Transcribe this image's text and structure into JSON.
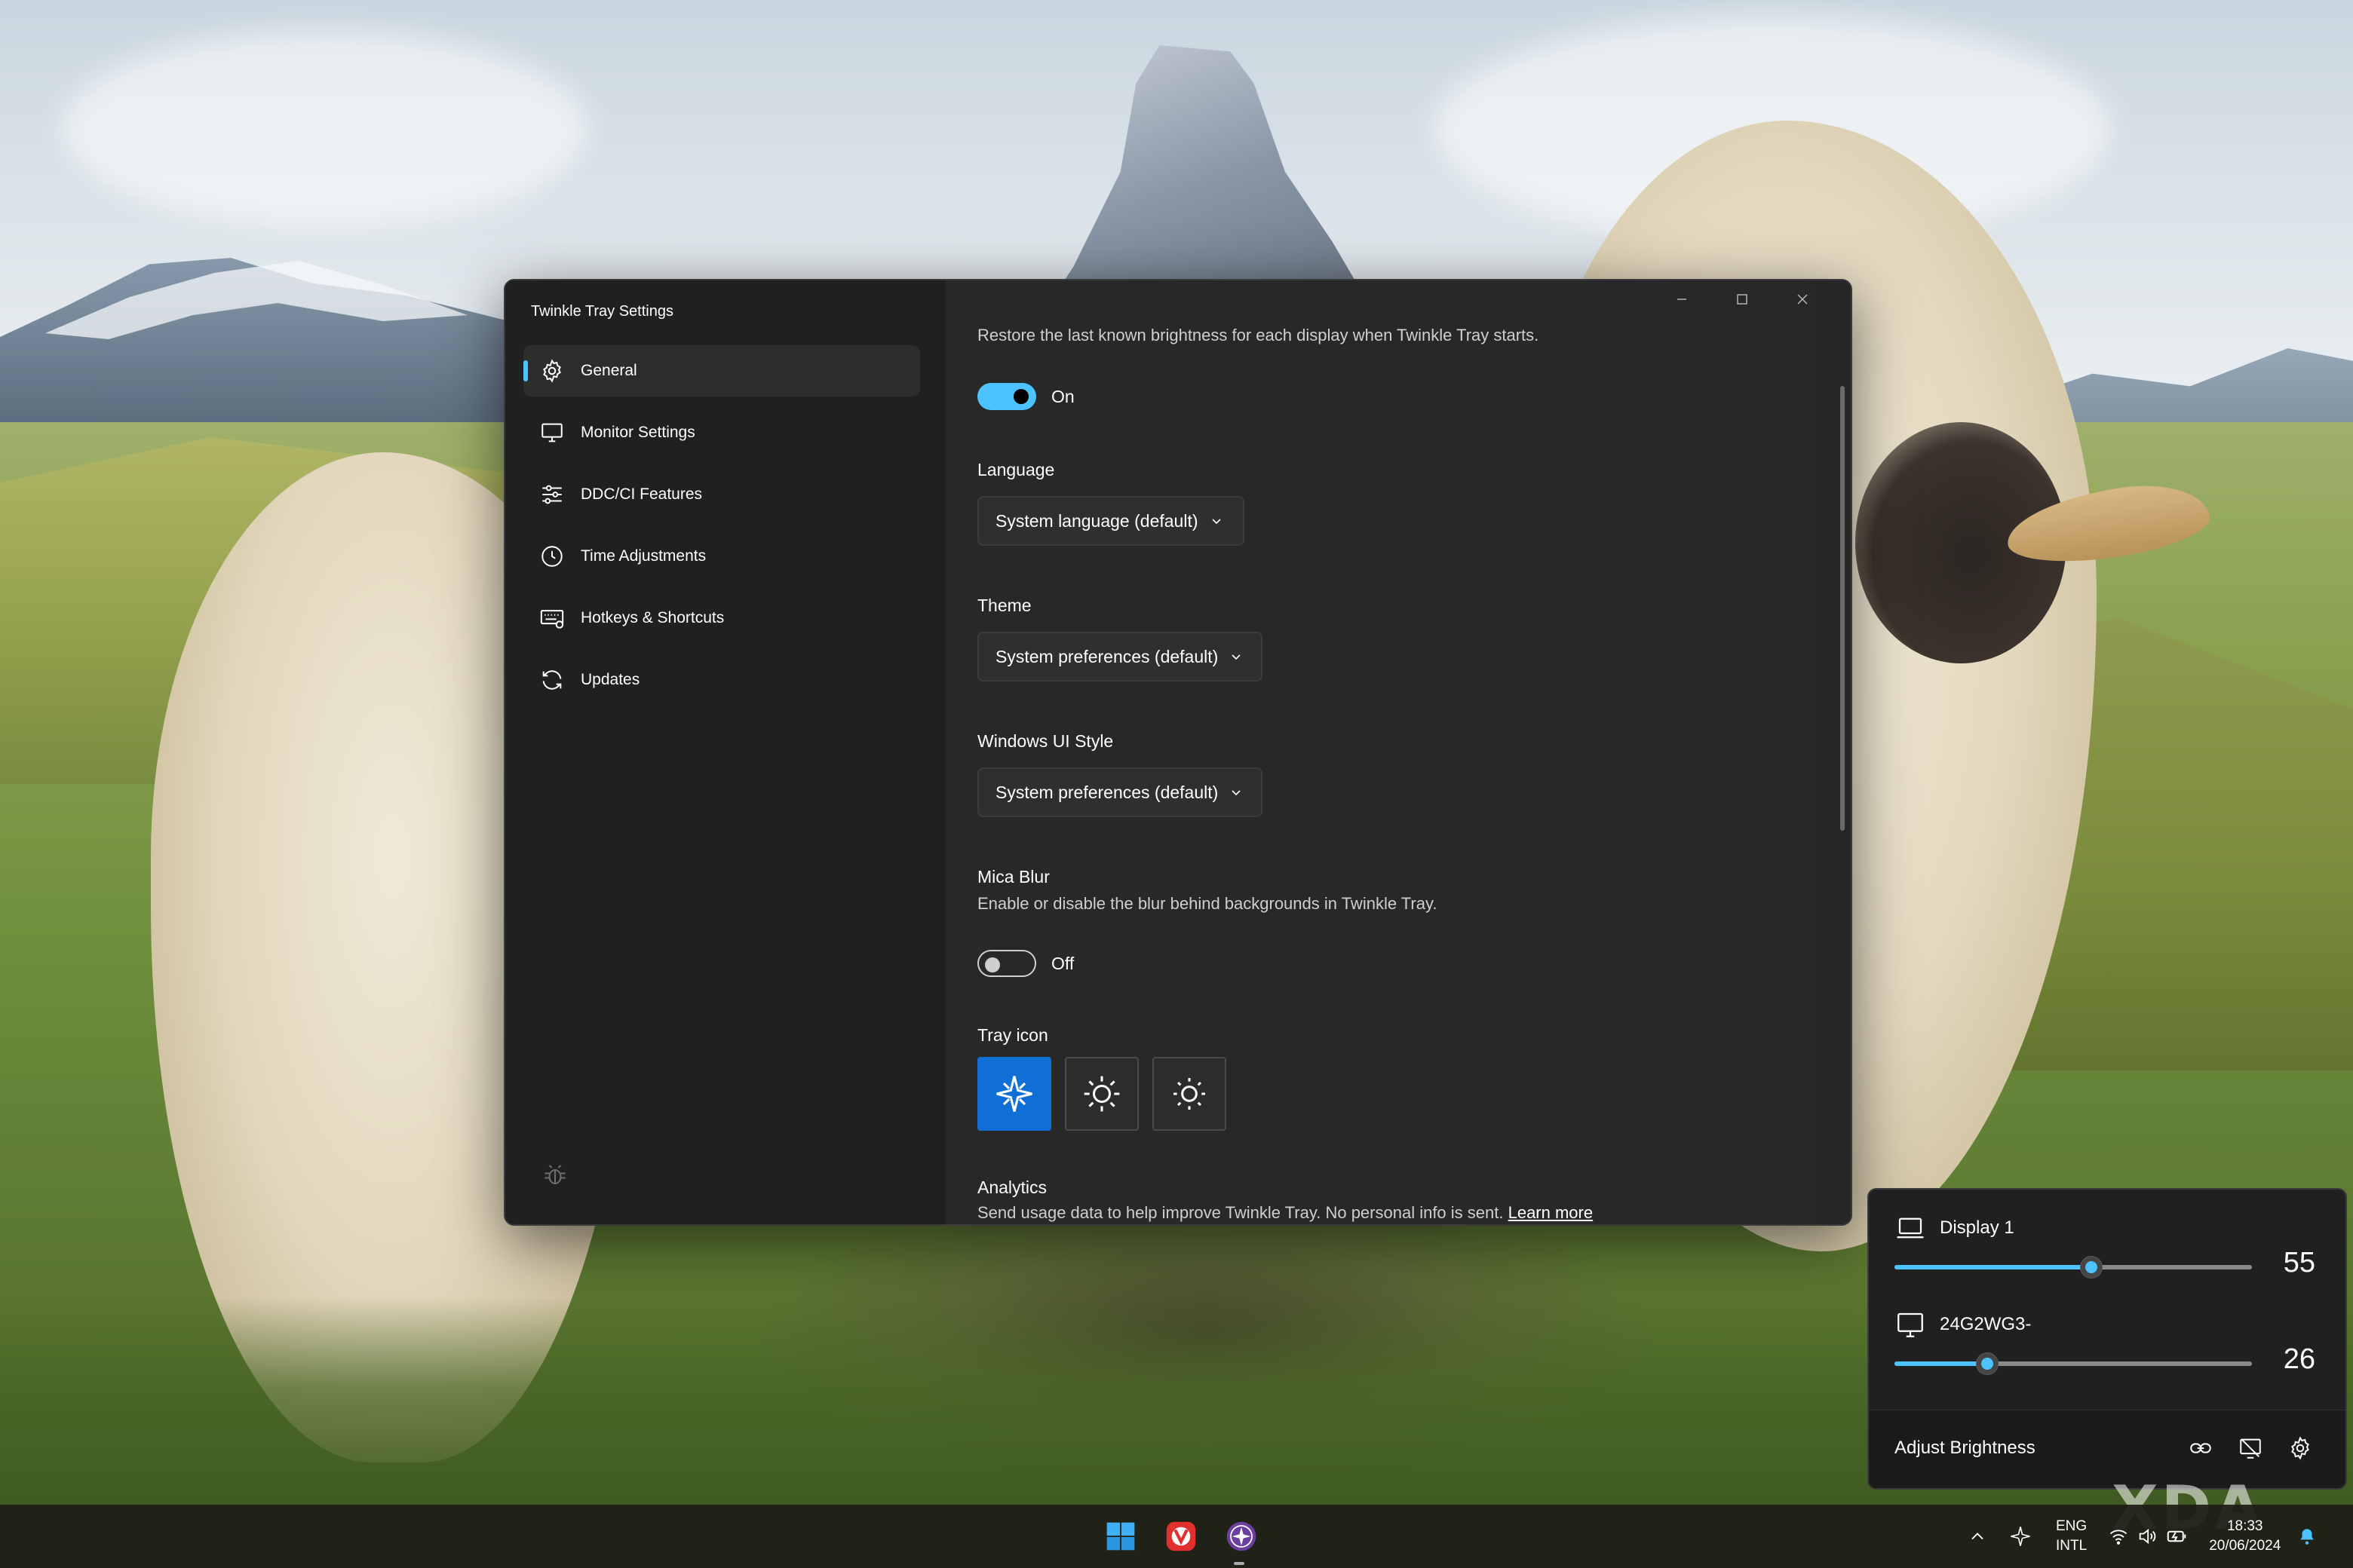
{
  "window": {
    "title": "Twinkle Tray Settings",
    "controls": [
      "minimize-icon",
      "maximize-icon",
      "close-icon"
    ]
  },
  "sidebar": {
    "items": [
      {
        "label": "General",
        "icon": "gear-icon",
        "active": true
      },
      {
        "label": "Monitor Settings",
        "icon": "monitor-icon",
        "active": false
      },
      {
        "label": "DDC/CI Features",
        "icon": "sliders-icon",
        "active": false
      },
      {
        "label": "Time Adjustments",
        "icon": "clock-icon",
        "active": false
      },
      {
        "label": "Hotkeys & Shortcuts",
        "icon": "keyboard-icon",
        "active": false
      },
      {
        "label": "Updates",
        "icon": "sync-icon",
        "active": false
      }
    ],
    "footer_icon": "bug-icon"
  },
  "content": {
    "restore_brightness": {
      "description": "Restore the last known brightness for each display when Twinkle Tray starts.",
      "toggle_state": "On"
    },
    "language": {
      "title": "Language",
      "value": "System language (default)"
    },
    "theme": {
      "title": "Theme",
      "value": "System preferences (default)"
    },
    "windows_ui_style": {
      "title": "Windows UI Style",
      "value": "System preferences (default)"
    },
    "mica_blur": {
      "title": "Mica Blur",
      "description": "Enable or disable the blur behind backgrounds in Twinkle Tray.",
      "toggle_state": "Off"
    },
    "tray_icon": {
      "title": "Tray icon",
      "options": [
        "sparkle-icon",
        "sun-outline-icon",
        "sun-icon"
      ],
      "selected_index": 0
    },
    "analytics": {
      "title": "Analytics",
      "description": "Send usage data to help improve Twinkle Tray. No personal info is sent.",
      "link": "Learn more"
    }
  },
  "flyout": {
    "monitors": [
      {
        "name": "Display 1",
        "icon": "laptop-icon",
        "level": 55
      },
      {
        "name": "24G2WG3-",
        "icon": "monitor-icon",
        "level": 26
      }
    ],
    "footer_title": "Adjust Brightness",
    "footer_buttons": [
      "link-icon",
      "display-off-icon",
      "gear-icon"
    ]
  },
  "taskbar": {
    "apps": [
      "windows-start-icon",
      "vivaldi-icon",
      "twinkle-tray-icon"
    ],
    "language_line1": "ENG",
    "language_line2": "INTL",
    "time": "18:33",
    "date": "20/06/2024"
  },
  "watermark": "XDA",
  "colors": {
    "accent": "#4cc2ff",
    "selected_tile": "#0f6fd6",
    "window_bg": "#202020",
    "content_bg": "#282828"
  }
}
